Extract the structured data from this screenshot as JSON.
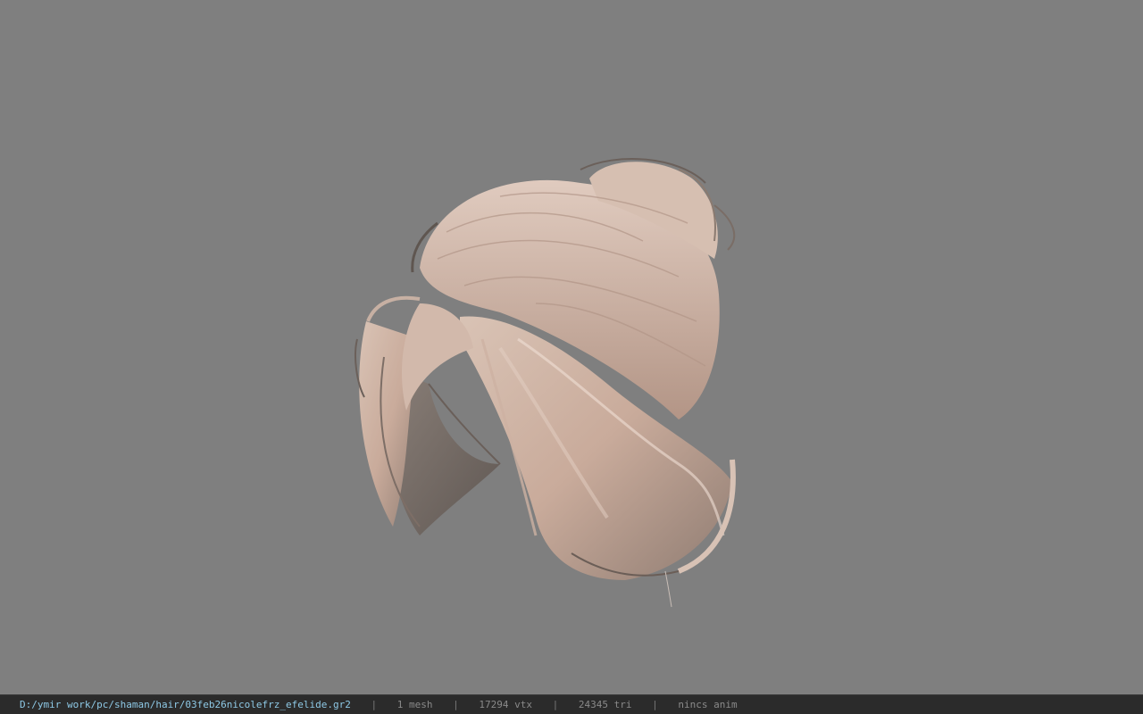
{
  "viewport": {
    "background": "#7f7f7f",
    "model_icon": "hair-mesh-icon"
  },
  "statusbar": {
    "file_path": "D:/ymir work/pc/shaman/hair/03feb26nicolefrz_efelide.gr2",
    "separator": "|",
    "mesh_count": "1 mesh",
    "vertex_count": "17294 vtx",
    "triangle_count": "24345 tri",
    "animation": "nincs anim",
    "path_color": "#8ec9e6",
    "text_color": "#8a8a8a"
  }
}
